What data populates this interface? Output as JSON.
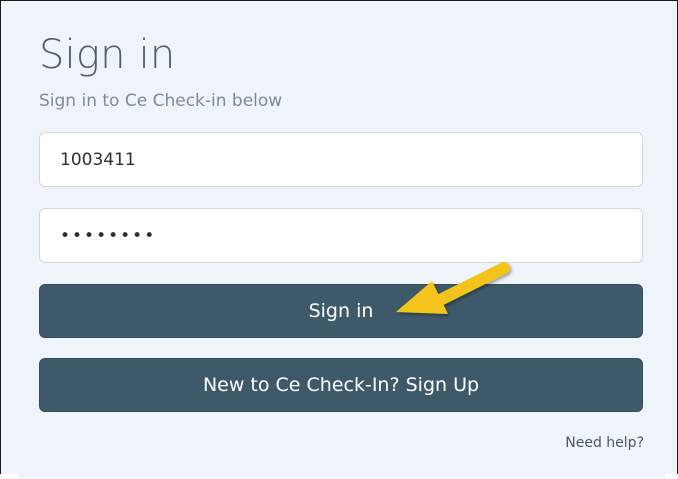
{
  "form": {
    "title": "Sign in",
    "subtitle": "Sign in to Ce Check-in below",
    "username_value": "1003411",
    "password_value": "••••••••",
    "signin_label": "Sign in",
    "signup_label": "New to Ce Check-In? Sign Up",
    "help_label": "Need help?"
  },
  "colors": {
    "button": "#3e5a6a",
    "background": "#eef4f9",
    "annotation_arrow": "#f5c41b"
  },
  "icons": {
    "annotation": "yellow-arrow-icon"
  }
}
